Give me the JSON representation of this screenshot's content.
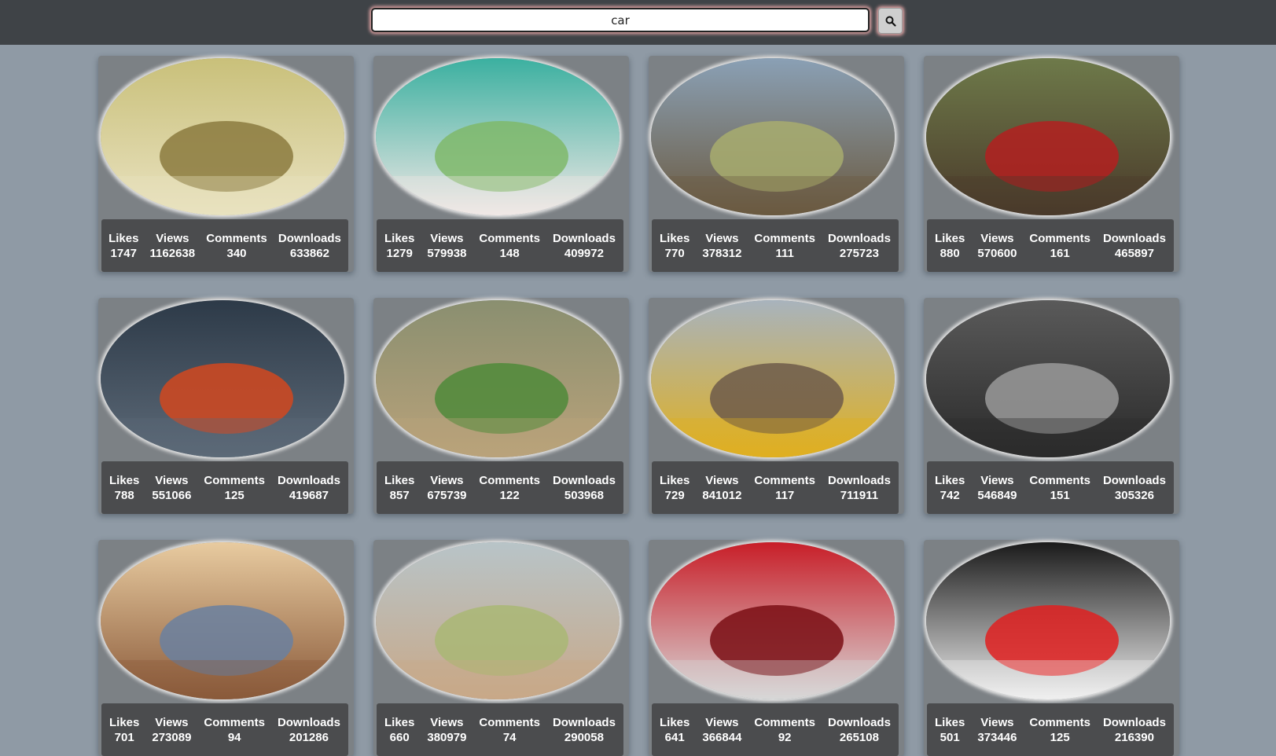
{
  "search": {
    "value": "car",
    "button_icon": "search-icon"
  },
  "stat_labels": {
    "likes": "Likes",
    "views": "Views",
    "comments": "Comments",
    "downloads": "Downloads"
  },
  "cards": [
    {
      "likes": "1747",
      "views": "1162638",
      "comments": "340",
      "downloads": "633862",
      "image": "legs-sneakers",
      "palette": [
        "#c9c07a",
        "#8b7a3e",
        "#e9e2c0"
      ]
    },
    {
      "likes": "1279",
      "views": "579938",
      "comments": "148",
      "downloads": "409972",
      "image": "woman-driving-convertible",
      "palette": [
        "#3bb0a0",
        "#7fb86a",
        "#f1e8e6"
      ]
    },
    {
      "likes": "770",
      "views": "378312",
      "comments": "111",
      "downloads": "275723",
      "image": "woman-beetle-beach",
      "palette": [
        "#8aa0b5",
        "#a8ad6e",
        "#6b5a40"
      ]
    },
    {
      "likes": "880",
      "views": "570600",
      "comments": "161",
      "downloads": "465897",
      "image": "red-fiat-forest",
      "palette": [
        "#6e7a4a",
        "#b32020",
        "#4a3a2a"
      ]
    },
    {
      "likes": "788",
      "views": "551066",
      "comments": "125",
      "downloads": "419687",
      "image": "porsche-city-night",
      "palette": [
        "#2d3a48",
        "#d2481e",
        "#5d6a78"
      ]
    },
    {
      "likes": "857",
      "views": "675739",
      "comments": "122",
      "downloads": "503968",
      "image": "red-classic-car-field",
      "palette": [
        "#8a8f70",
        "#4f8a3a",
        "#b9a27a"
      ]
    },
    {
      "likes": "729",
      "views": "841012",
      "comments": "117",
      "downloads": "711911",
      "image": "city-street-taxi",
      "palette": [
        "#a8b3bd",
        "#6d5a4a",
        "#e0b020"
      ]
    },
    {
      "likes": "742",
      "views": "546849",
      "comments": "151",
      "downloads": "305326",
      "image": "mechanic-beetle-bw",
      "palette": [
        "#5a5a5a",
        "#9a9a9a",
        "#2a2a2a"
      ]
    },
    {
      "likes": "701",
      "views": "273089",
      "comments": "94",
      "downloads": "201286",
      "image": "biplane-mountains",
      "palette": [
        "#e8cba0",
        "#6a80a0",
        "#8a5a3a"
      ]
    },
    {
      "likes": "660",
      "views": "380979",
      "comments": "74",
      "downloads": "290058",
      "image": "woman-beetle-luggage",
      "palette": [
        "#b8c4c8",
        "#a9b774",
        "#c8a888"
      ]
    },
    {
      "likes": "641",
      "views": "366844",
      "comments": "92",
      "downloads": "265108",
      "image": "red-mustang-headlight",
      "palette": [
        "#c81e28",
        "#7a0e14",
        "#d8d8d8"
      ]
    },
    {
      "likes": "501",
      "views": "373446",
      "comments": "125",
      "downloads": "216390",
      "image": "light-trails-highway",
      "palette": [
        "#1a1a1a",
        "#e02020",
        "#f0f0f0"
      ]
    }
  ]
}
